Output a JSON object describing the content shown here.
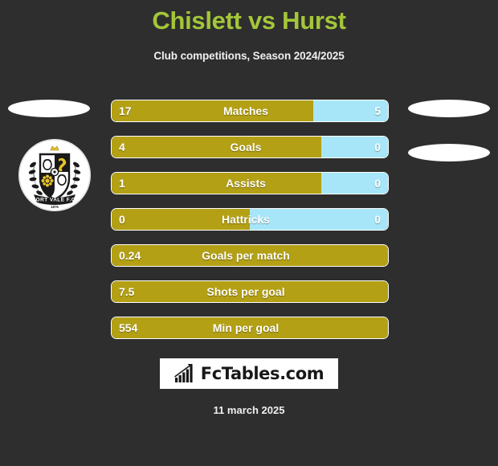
{
  "header": {
    "title": "Chislett vs Hurst",
    "subtitle": "Club competitions, Season 2024/2025",
    "title_color": "#a4c639"
  },
  "crest": {
    "name": "Port Vale F.C.",
    "banner_text": "PORT VALE F.C.",
    "founded": "1876"
  },
  "watermark": {
    "text": "FcTables.com",
    "icon": "bar-chart-growth-icon"
  },
  "footer": {
    "date": "11 march 2025"
  },
  "colors": {
    "left_bar": "#b3a015",
    "right_bar": "#a7e6f8",
    "background": "#2e2e2e",
    "title": "#a4c639"
  },
  "chart_data": {
    "type": "bar",
    "title": "Chislett vs Hurst",
    "subtitle": "Club competitions, Season 2024/2025",
    "orientation": "horizontal-diverging",
    "legend": [
      "Chislett",
      "Hurst"
    ],
    "series": [
      {
        "name": "Chislett",
        "color": "#b3a015",
        "values": [
          17,
          4,
          1,
          0,
          0.24,
          7.5,
          554
        ]
      },
      {
        "name": "Hurst",
        "color": "#a7e6f8",
        "values": [
          5,
          0,
          0,
          0,
          null,
          null,
          null
        ]
      }
    ],
    "categories": [
      "Matches",
      "Goals",
      "Assists",
      "Hattricks",
      "Goals per match",
      "Shots per goal",
      "Min per goal"
    ],
    "rows": [
      {
        "label": "Matches",
        "left_value": "17",
        "right_value": "5",
        "left_pct": 73,
        "has_right": true
      },
      {
        "label": "Goals",
        "left_value": "4",
        "right_value": "0",
        "left_pct": 76,
        "has_right": true
      },
      {
        "label": "Assists",
        "left_value": "1",
        "right_value": "0",
        "left_pct": 76,
        "has_right": true
      },
      {
        "label": "Hattricks",
        "left_value": "0",
        "right_value": "0",
        "left_pct": 50,
        "has_right": true
      },
      {
        "label": "Goals per match",
        "left_value": "0.24",
        "right_value": "",
        "left_pct": 100,
        "has_right": false
      },
      {
        "label": "Shots per goal",
        "left_value": "7.5",
        "right_value": "",
        "left_pct": 100,
        "has_right": false
      },
      {
        "label": "Min per goal",
        "left_value": "554",
        "right_value": "",
        "left_pct": 100,
        "has_right": false
      }
    ]
  }
}
